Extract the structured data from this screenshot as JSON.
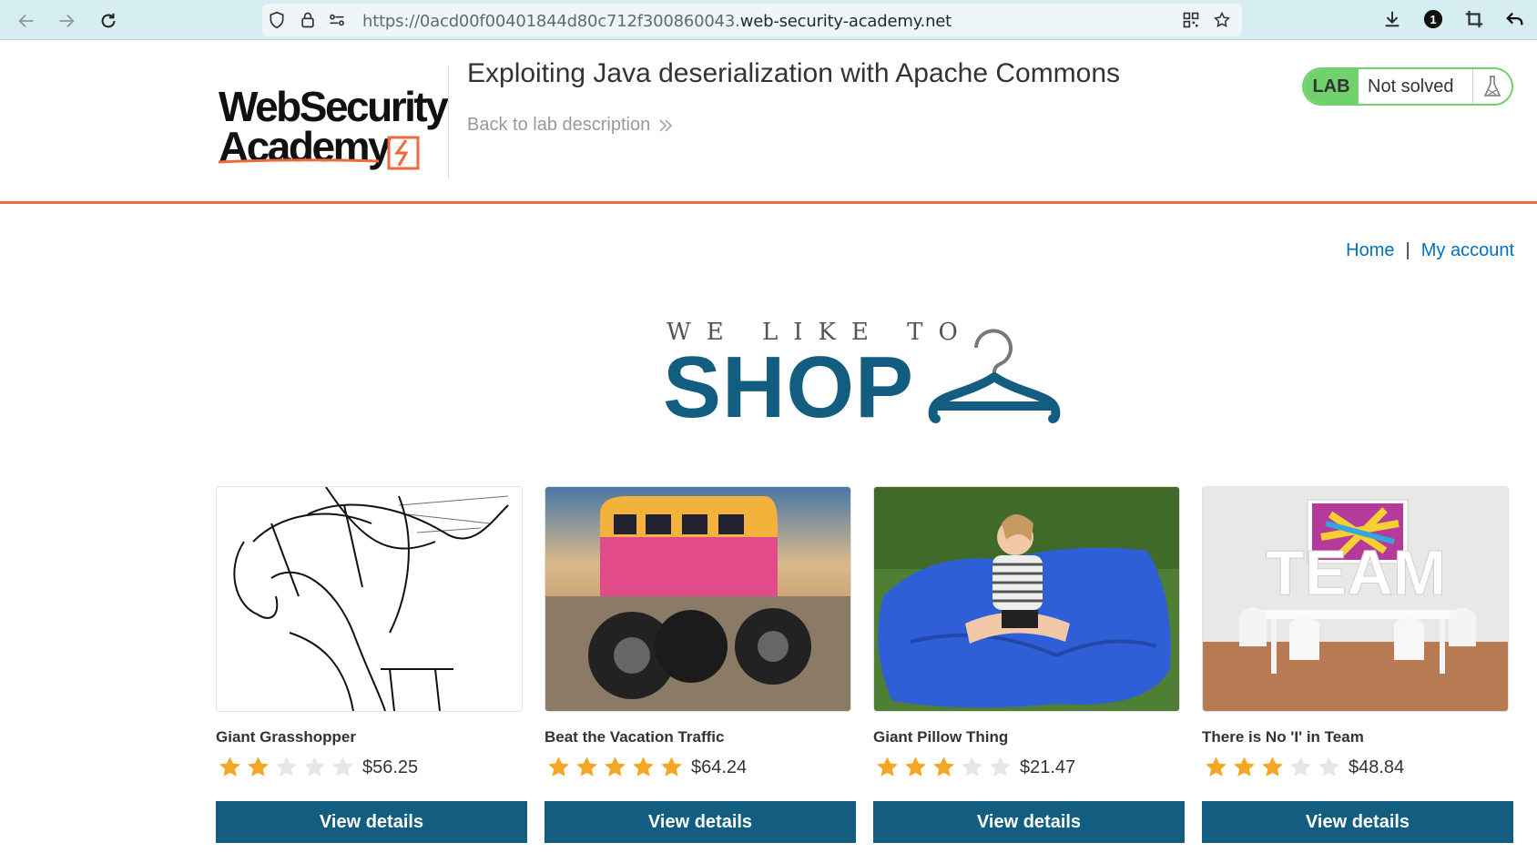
{
  "browser": {
    "url_prefix": "https://0acd00f00401844d80c712f300860043.",
    "url_host": "web-security-academy.net",
    "notification_count": "1"
  },
  "lab": {
    "logo_line1": "WebSecurity",
    "logo_line2": "Academy",
    "title": "Exploiting Java deserialization with Apache Commons",
    "back_link": "Back to lab description",
    "badge": "LAB",
    "status": "Not solved",
    "accent_color": "#ee6a3a",
    "status_color": "#70d16d"
  },
  "nav": {
    "home": "Home",
    "separator": "|",
    "account": "My account"
  },
  "hero": {
    "subtitle": "WE LIKE TO",
    "title": "SHOP",
    "brand_color": "#135d80"
  },
  "products": [
    {
      "name": "Giant Grasshopper",
      "rating": 2,
      "max_rating": 5,
      "price": "$56.25",
      "button": "View details",
      "image": "grasshopper-sketch"
    },
    {
      "name": "Beat the Vacation Traffic",
      "rating": 5,
      "max_rating": 5,
      "price": "$64.24",
      "button": "View details",
      "image": "monster-van"
    },
    {
      "name": "Giant Pillow Thing",
      "rating": 3,
      "max_rating": 5,
      "price": "$21.47",
      "button": "View details",
      "image": "blue-pillow"
    },
    {
      "name": "There is No 'I' in Team",
      "rating": 3,
      "max_rating": 5,
      "price": "$48.84",
      "button": "View details",
      "image": "team-room"
    }
  ]
}
